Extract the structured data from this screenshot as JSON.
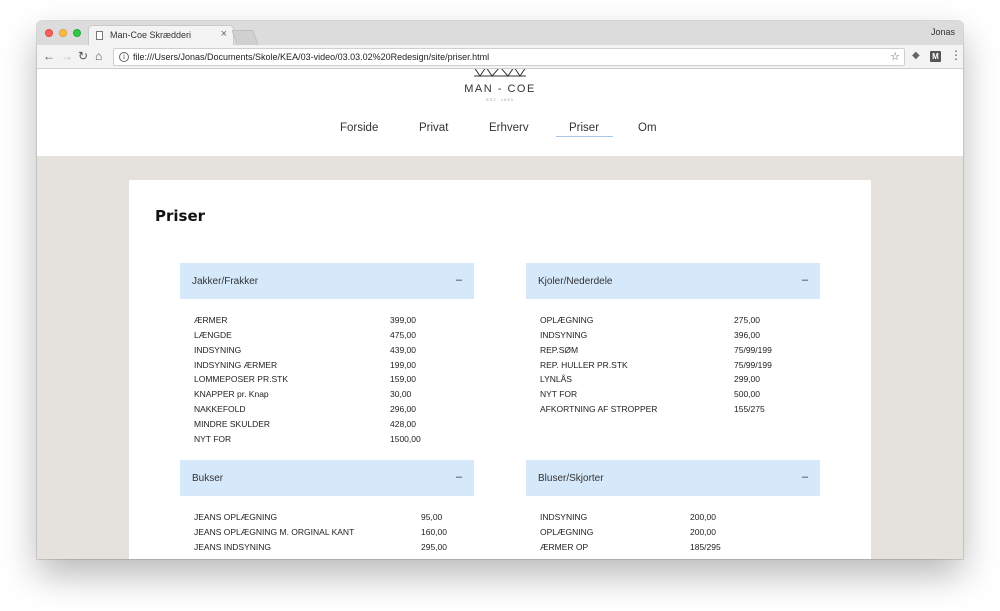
{
  "browser": {
    "tab_title": "Man-Coe Skrædderi",
    "tab_close": "×",
    "profile_name": "Jonas",
    "url": "file:///Users/Jonas/Documents/Skole/KEA/03-video/03.03.02%20Redesign/site/priser.html",
    "back_icon": "←",
    "forward_icon": "→",
    "reload_icon": "↻",
    "home_icon": "⌂",
    "info_icon": "i",
    "star_icon": "☆",
    "extension_icon": "M",
    "menu_icon": "⋮"
  },
  "site": {
    "logo_name": "MAN - COE",
    "logo_est": "EST. 1993",
    "nav": [
      "Forside",
      "Privat",
      "Erhverv",
      "Priser",
      "Om"
    ],
    "active_nav": "Priser"
  },
  "page": {
    "title": "Priser"
  },
  "sections": [
    {
      "title": "Jakker/Frakker",
      "toggle": "–",
      "rows": [
        {
          "item": "ÆRMER",
          "price": "399,00"
        },
        {
          "item": "LÆNGDE",
          "price": "475,00"
        },
        {
          "item": "INDSYNING",
          "price": "439,00"
        },
        {
          "item": "INDSYNING ÆRMER",
          "price": "199,00"
        },
        {
          "item": "LOMMEPOSER PR.STK",
          "price": "159,00"
        },
        {
          "item": "KNAPPER pr. Knap",
          "price": "30,00"
        },
        {
          "item": "NAKKEFOLD",
          "price": "296,00"
        },
        {
          "item": "MINDRE SKULDER",
          "price": "428,00"
        },
        {
          "item": "NYT FOR",
          "price": "1500,00"
        }
      ]
    },
    {
      "title": "Kjoler/Nederdele",
      "toggle": "–",
      "rows": [
        {
          "item": "OPLÆGNING",
          "price": "275,00"
        },
        {
          "item": "INDSYNING",
          "price": "396,00"
        },
        {
          "item": "REP.SØM",
          "price": "75/99/199"
        },
        {
          "item": "REP. HULLER PR.STK",
          "price": "75/99/199"
        },
        {
          "item": "LYNLÅS",
          "price": "299,00"
        },
        {
          "item": "NYT FOR",
          "price": "500,00"
        },
        {
          "item": "AFKORTNING AF STROPPER",
          "price": "155/275"
        }
      ]
    },
    {
      "title": "Bukser",
      "toggle": "–",
      "rows": [
        {
          "item": "JEANS OPLÆGNING",
          "price": "95,00"
        },
        {
          "item": "JEANS OPLÆGNING M. ORGINAL KANT",
          "price": "160,00"
        },
        {
          "item": "JEANS INDSYNING",
          "price": "295,00"
        }
      ]
    },
    {
      "title": "Bluser/Skjorter",
      "toggle": "–",
      "rows": [
        {
          "item": "INDSYNING",
          "price": "200,00"
        },
        {
          "item": "OPLÆGNING",
          "price": "200,00"
        },
        {
          "item": "ÆRMER OP",
          "price": "185/295"
        }
      ]
    }
  ]
}
